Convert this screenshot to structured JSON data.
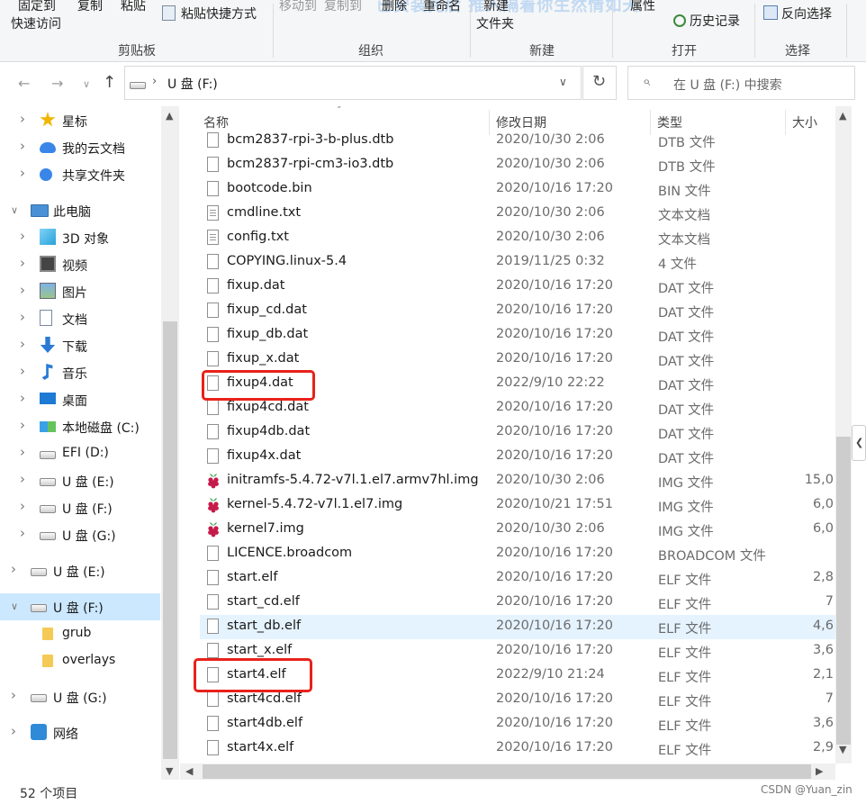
{
  "ribbon": {
    "watermark": "已安装完后 推入隔着你生然情如天",
    "clipboard": {
      "pin_line1": "固定到",
      "pin_line2": "快速访问",
      "copy": "复制",
      "paste": "粘贴",
      "paste_shortcut": "粘贴快捷方式",
      "group": "剪贴板"
    },
    "organize": {
      "move_to": "移动到",
      "copy_to": "复制到",
      "delete": "删除",
      "rename": "重命名",
      "group": "组织"
    },
    "new": {
      "new_folder_line1": "新建",
      "new_folder_line2": "文件夹",
      "group": "新建"
    },
    "open": {
      "properties": "属性",
      "history": "历史记录",
      "group": "打开"
    },
    "select": {
      "invert": "反向选择",
      "group": "选择"
    }
  },
  "address": {
    "path": "U 盘 (F:)",
    "search_placeholder": "在 U 盘 (F:) 中搜索"
  },
  "nav": [
    {
      "label": "星标",
      "icon": "star-icon",
      "level": 1
    },
    {
      "label": "我的云文档",
      "icon": "cloud-icon",
      "level": 1
    },
    {
      "label": "共享文件夹",
      "icon": "share-icon",
      "level": 1
    },
    {
      "label": "此电脑",
      "icon": "computer-icon",
      "level": 0
    },
    {
      "label": "3D 对象",
      "icon": "cube-icon",
      "level": 1
    },
    {
      "label": "视频",
      "icon": "video-icon",
      "level": 1
    },
    {
      "label": "图片",
      "icon": "picture-icon",
      "level": 1
    },
    {
      "label": "文档",
      "icon": "document-icon",
      "level": 1
    },
    {
      "label": "下载",
      "icon": "download-icon",
      "level": 1
    },
    {
      "label": "音乐",
      "icon": "music-icon",
      "level": 1
    },
    {
      "label": "桌面",
      "icon": "desktop-icon",
      "level": 1
    },
    {
      "label": "本地磁盘 (C:)",
      "icon": "windows-drive-icon",
      "level": 1
    },
    {
      "label": "EFI (D:)",
      "icon": "drive-icon",
      "level": 1
    },
    {
      "label": "U 盘 (E:)",
      "icon": "drive-icon",
      "level": 1
    },
    {
      "label": "U 盘 (F:)",
      "icon": "drive-icon",
      "level": 1
    },
    {
      "label": "U 盘 (G:)",
      "icon": "drive-icon",
      "level": 1
    },
    {
      "label": "U 盘 (E:)",
      "icon": "drive-icon",
      "level": 0
    },
    {
      "label": "U 盘 (F:)",
      "icon": "drive-icon",
      "level": 0,
      "selected": true,
      "expanded": true
    },
    {
      "label": "grub",
      "icon": "folder-icon",
      "level": 1
    },
    {
      "label": "overlays",
      "icon": "folder-icon",
      "level": 1
    },
    {
      "label": "U 盘 (G:)",
      "icon": "drive-icon",
      "level": 0
    },
    {
      "label": "网络",
      "icon": "network-icon",
      "level": 0
    }
  ],
  "columns": {
    "name": "名称",
    "date": "修改日期",
    "type": "类型",
    "size": "大小"
  },
  "files": [
    {
      "name": "bcm2837-rpi-3-b-plus.dtb",
      "date": "2020/10/30 2:06",
      "type": "DTB 文件",
      "size": "",
      "icon": "file-icon"
    },
    {
      "name": "bcm2837-rpi-cm3-io3.dtb",
      "date": "2020/10/30 2:06",
      "type": "DTB 文件",
      "size": "",
      "icon": "file-icon"
    },
    {
      "name": "bootcode.bin",
      "date": "2020/10/16 17:20",
      "type": "BIN 文件",
      "size": "",
      "icon": "file-icon"
    },
    {
      "name": "cmdline.txt",
      "date": "2020/10/30 2:06",
      "type": "文本文档",
      "size": "",
      "icon": "text-file-icon"
    },
    {
      "name": "config.txt",
      "date": "2020/10/30 2:06",
      "type": "文本文档",
      "size": "",
      "icon": "text-file-icon"
    },
    {
      "name": "COPYING.linux-5.4",
      "date": "2019/11/25 0:32",
      "type": "4 文件",
      "size": "",
      "icon": "file-icon"
    },
    {
      "name": "fixup.dat",
      "date": "2020/10/16 17:20",
      "type": "DAT 文件",
      "size": "",
      "icon": "file-icon"
    },
    {
      "name": "fixup_cd.dat",
      "date": "2020/10/16 17:20",
      "type": "DAT 文件",
      "size": "",
      "icon": "file-icon"
    },
    {
      "name": "fixup_db.dat",
      "date": "2020/10/16 17:20",
      "type": "DAT 文件",
      "size": "",
      "icon": "file-icon"
    },
    {
      "name": "fixup_x.dat",
      "date": "2020/10/16 17:20",
      "type": "DAT 文件",
      "size": "",
      "icon": "file-icon"
    },
    {
      "name": "fixup4.dat",
      "date": "2022/9/10 22:22",
      "type": "DAT 文件",
      "size": "",
      "icon": "file-icon",
      "highlight": true
    },
    {
      "name": "fixup4cd.dat",
      "date": "2020/10/16 17:20",
      "type": "DAT 文件",
      "size": "",
      "icon": "file-icon"
    },
    {
      "name": "fixup4db.dat",
      "date": "2020/10/16 17:20",
      "type": "DAT 文件",
      "size": "",
      "icon": "file-icon"
    },
    {
      "name": "fixup4x.dat",
      "date": "2020/10/16 17:20",
      "type": "DAT 文件",
      "size": "",
      "icon": "file-icon"
    },
    {
      "name": "initramfs-5.4.72-v7l.1.el7.armv7hl.img",
      "date": "2020/10/30 2:06",
      "type": "IMG 文件",
      "size": "15,0",
      "icon": "raspberry-icon"
    },
    {
      "name": "kernel-5.4.72-v7l.1.el7.img",
      "date": "2020/10/21 17:51",
      "type": "IMG 文件",
      "size": "6,0",
      "icon": "raspberry-icon"
    },
    {
      "name": "kernel7.img",
      "date": "2020/10/30 2:06",
      "type": "IMG 文件",
      "size": "6,0",
      "icon": "raspberry-icon"
    },
    {
      "name": "LICENCE.broadcom",
      "date": "2020/10/16 17:20",
      "type": "BROADCOM 文件",
      "size": "",
      "icon": "file-icon"
    },
    {
      "name": "start.elf",
      "date": "2020/10/16 17:20",
      "type": "ELF 文件",
      "size": "2,8",
      "icon": "file-icon"
    },
    {
      "name": "start_cd.elf",
      "date": "2020/10/16 17:20",
      "type": "ELF 文件",
      "size": "7",
      "icon": "file-icon"
    },
    {
      "name": "start_db.elf",
      "date": "2020/10/16 17:20",
      "type": "ELF 文件",
      "size": "4,6",
      "icon": "file-icon",
      "hover": true
    },
    {
      "name": "start_x.elf",
      "date": "2020/10/16 17:20",
      "type": "ELF 文件",
      "size": "3,6",
      "icon": "file-icon"
    },
    {
      "name": "start4.elf",
      "date": "2022/9/10 21:24",
      "type": "ELF 文件",
      "size": "2,1",
      "icon": "file-icon",
      "highlight": true
    },
    {
      "name": "start4cd.elf",
      "date": "2020/10/16 17:20",
      "type": "ELF 文件",
      "size": "7",
      "icon": "file-icon"
    },
    {
      "name": "start4db.elf",
      "date": "2020/10/16 17:20",
      "type": "ELF 文件",
      "size": "3,6",
      "icon": "file-icon"
    },
    {
      "name": "start4x.elf",
      "date": "2020/10/16 17:20",
      "type": "ELF 文件",
      "size": "2,9",
      "icon": "file-icon"
    }
  ],
  "status": {
    "item_count": "52 个项目",
    "credit": "CSDN @Yuan_zin"
  },
  "colors": {
    "highlight_box": "#e8221b",
    "selected_bg": "#cce8ff",
    "hover_bg": "#e5f3ff"
  }
}
